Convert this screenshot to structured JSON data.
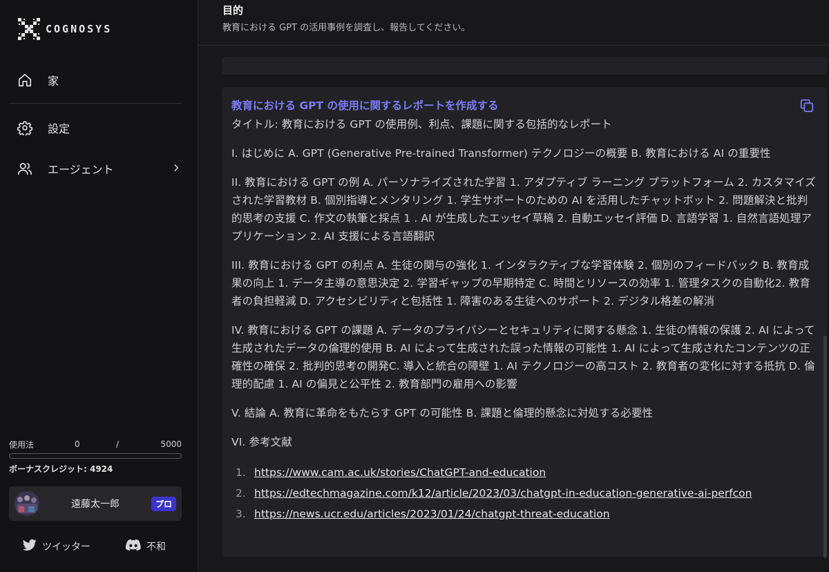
{
  "brand": {
    "name": "COGNOSYS"
  },
  "nav": {
    "home": "家",
    "settings": "設定",
    "agents": "エージェント"
  },
  "usage": {
    "label": "使用法",
    "used": "0",
    "separator": "/",
    "total": "5000",
    "fraction": 0
  },
  "bonus": {
    "text": "ボーナスクレジット: 4924"
  },
  "user": {
    "name": "遠藤太一郎",
    "badge": "プロ"
  },
  "social": {
    "twitter": "ツイッター",
    "discord": "不和"
  },
  "objective": {
    "title": "目的",
    "text": "教育における GPT の活用事例を調査し、報告してください。"
  },
  "result": {
    "task_title": "教育における GPT の使用に関するレポートを作成する",
    "title_line": "タイトル: 教育における GPT の使用例、利点、課題に関する包括的なレポート",
    "sec1": "I. はじめに A. GPT (Generative Pre-trained Transformer) テクノロジーの概要 B. 教育における AI の重要性",
    "sec2": "II. 教育における GPT の例 A. パーソナライズされた学習 1. アダプティブ ラーニング プラットフォーム 2. カスタマイズされた学習教材 B. 個別指導とメンタリング 1. 学生サポートのための AI を活用したチャットボット 2. 問題解決と批判的思考の支援 C. 作文の執筆と採点 1 . AI が生成したエッセイ草稿 2. 自動エッセイ評価 D. 言語学習 1. 自然言語処理アプリケーション 2. AI 支援による言語翻訳",
    "sec3": "III.   教育における GPT の利点 A. 生徒の関与の強化 1. インタラクティブな学習体験 2. 個別のフィードバック B. 教育成果の向上 1. データ主導の意思決定 2. 学習ギャップの早期特定 C. 時間とリソースの効率 1. 管理タスクの自動化2. 教育者の負担軽減 D. アクセシビリティと包括性 1. 障害のある生徒へのサポート 2. デジタル格差の解消",
    "sec4": "IV. 教育における GPT の課題 A. データのプライバシーとセキュリティに関する懸念 1. 生徒の情報の保護 2. AI によって生成されたデータの倫理的使用 B. AI によって生成された誤った情報の可能性 1. AI によって生成されたコンテンツの正確性の確保 2. 批判的思考の開発C. 導入と統合の障壁 1. AI テクノロジーの高コスト 2. 教育者の変化に対する抵抗 D. 倫理的配慮 1. AI の偏見と公平性 2. 教育部門の雇用への影響",
    "sec5": "V. 結論 A. 教育に革命をもたらす GPT の可能性 B. 課題と倫理的懸念に対処する必要性",
    "sec6": "VI. 参考文献",
    "references": [
      {
        "num": "1.",
        "url": "https://www.cam.ac.uk/stories/ChatGPT-and-education"
      },
      {
        "num": "2.",
        "url": "https://edtechmagazine.com/k12/article/2023/03/chatgpt-in-education-generative-ai-perfcon"
      },
      {
        "num": "3.",
        "url": "https://news.ucr.edu/articles/2023/01/24/chatgpt-threat-education"
      }
    ]
  },
  "icons": {
    "logo": "cognosys-logo-icon",
    "home": "home-icon",
    "settings": "gear-icon",
    "agents": "users-icon",
    "chevron": "chevron-right-icon",
    "copy": "copy-icon",
    "twitter": "twitter-icon",
    "discord": "discord-icon"
  },
  "colors": {
    "accent": "#7b7cf5",
    "badge": "#3b34c9",
    "background": "#18181b",
    "sidebar": "#131315",
    "card": "#222226"
  }
}
